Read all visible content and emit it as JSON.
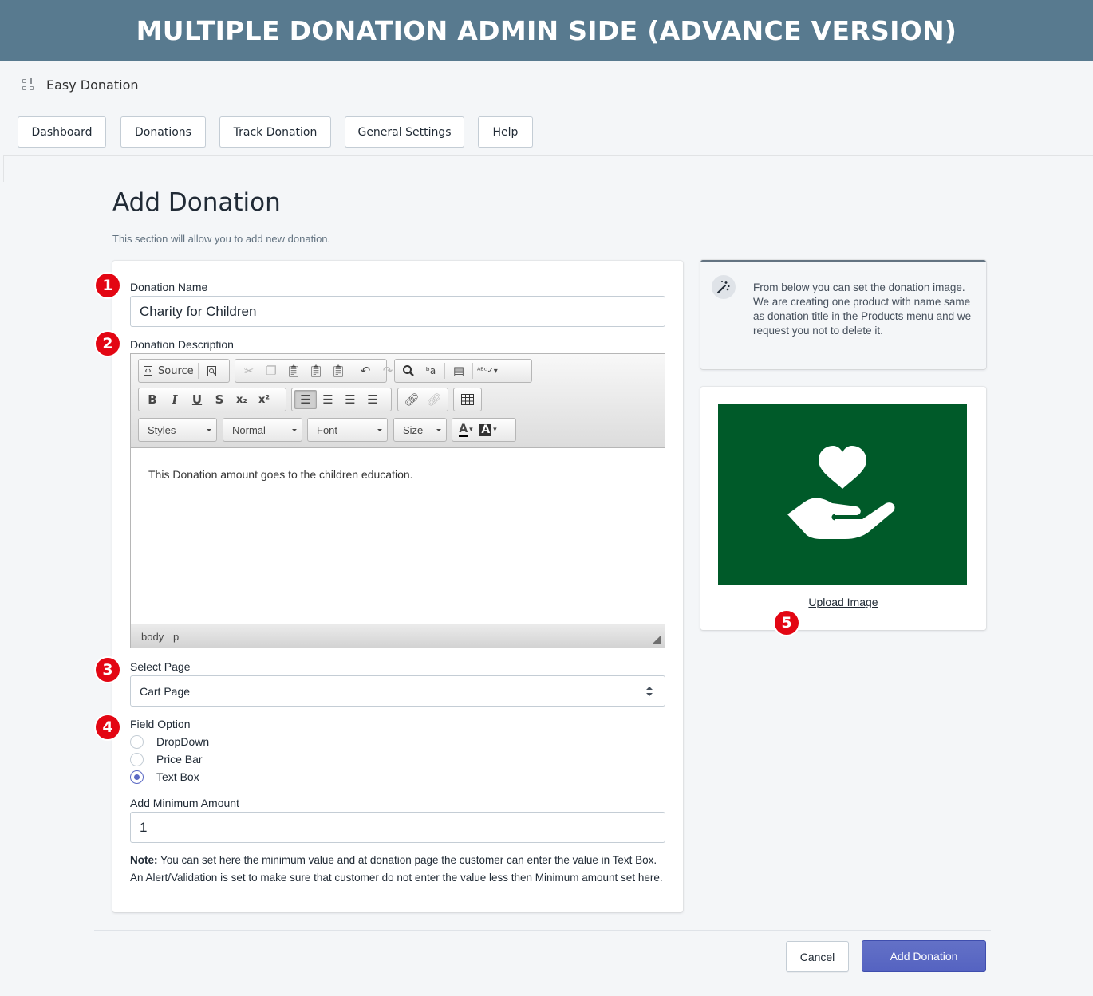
{
  "banner": {
    "title": "MULTIPLE DONATION ADMIN SIDE (ADVANCE VERSION)"
  },
  "app": {
    "name": "Easy Donation",
    "icon": "apps-icon"
  },
  "nav": {
    "items": [
      {
        "label": "Dashboard"
      },
      {
        "label": "Donations"
      },
      {
        "label": "Track Donation"
      },
      {
        "label": "General Settings"
      },
      {
        "label": "Help"
      }
    ]
  },
  "page": {
    "title": "Add Donation",
    "subtitle": "This section will allow you to add new donation."
  },
  "badges": [
    "1",
    "2",
    "3",
    "4",
    "5"
  ],
  "form": {
    "donation_name": {
      "label": "Donation Name",
      "value": "Charity for Children"
    },
    "donation_description": {
      "label": "Donation Description",
      "content": "This Donation amount goes to the children education.",
      "toolbar": {
        "source_label": "Source",
        "styles": "Styles",
        "format": "Normal",
        "font": "Font",
        "size": "Size"
      },
      "path": [
        "body",
        "p"
      ]
    },
    "select_page": {
      "label": "Select Page",
      "value": "Cart Page"
    },
    "field_option": {
      "label": "Field Option",
      "options": [
        {
          "label": "DropDown",
          "checked": false
        },
        {
          "label": "Price Bar",
          "checked": false
        },
        {
          "label": "Text Box",
          "checked": true
        }
      ]
    },
    "min_amount": {
      "label": "Add Minimum Amount",
      "value": "1"
    },
    "note": {
      "prefix": "Note:",
      "text": " You can set here the minimum value and at donation page the customer can enter the value in Text Box. An Alert/Validation is set to make sure that customer do not enter the value less then Minimum amount set here."
    }
  },
  "sidebar": {
    "info_text": "From below you can set the donation image. We are creating one product with name same as donation title in the Products menu and we request you not to delete it.",
    "upload_label": "Upload Image",
    "image_bg": "#005a29"
  },
  "actions": {
    "cancel": "Cancel",
    "submit": "Add Donation"
  },
  "colors": {
    "banner": "#587a8f",
    "primary": "#5c6ac4",
    "badge": "#e30613"
  }
}
